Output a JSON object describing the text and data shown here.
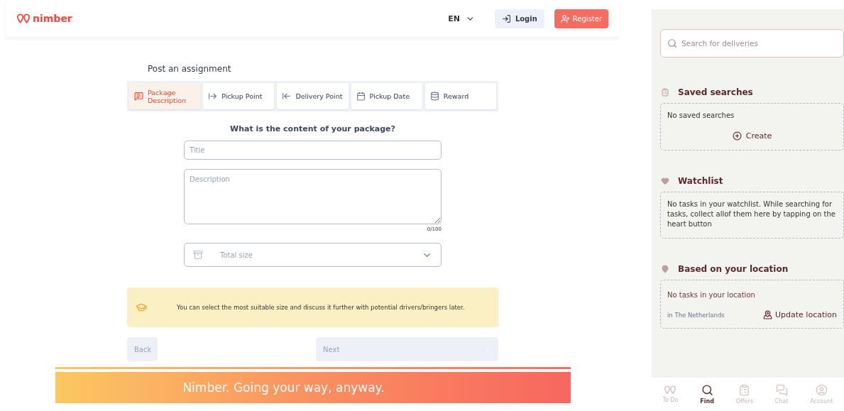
{
  "header": {
    "logo": "nimber",
    "language": "EN",
    "login": "Login",
    "register": "Register"
  },
  "form": {
    "title": "Post an assignment",
    "steps": [
      {
        "label": "Package Description",
        "selected": true
      },
      {
        "label": "Pickup Point",
        "selected": false
      },
      {
        "label": "Delivery Point",
        "selected": false
      },
      {
        "label": "Pickup Date",
        "selected": false
      },
      {
        "label": "Reward",
        "selected": false
      }
    ],
    "question": "What is the content of your package?",
    "title_field": {
      "placeholder": "Title"
    },
    "description_field": {
      "placeholder": "Description",
      "counter": "0/100"
    },
    "size_select": {
      "placeholder": "Total size"
    },
    "info": "You can select the most suitable size and discuss it further with potential drivers/bringers later.",
    "back": {
      "label": "Back",
      "disabled": true
    },
    "next": {
      "label": "Next",
      "disabled": true
    }
  },
  "banner": "Nimber. Going your way, anyway.",
  "sidebar": {
    "search": {
      "placeholder": "Search for deliveries"
    },
    "sections": [
      {
        "title": "Saved searches",
        "message": "No saved searches",
        "action": "Create"
      },
      {
        "title": "Watchlist",
        "message": "No tasks in your watchlist. While searching for tasks, collect allof them here by tapping on the heart button"
      },
      {
        "title": "Based on your location",
        "message": "No tasks in your location",
        "note": "in The Netherlands",
        "action": "Update location"
      }
    ]
  },
  "bottom_nav": [
    {
      "label": "To Do",
      "selected": false
    },
    {
      "label": "Find",
      "selected": true
    },
    {
      "label": "Offers",
      "selected": false
    },
    {
      "label": "Chat",
      "selected": false
    },
    {
      "label": "Account",
      "selected": false
    }
  ]
}
